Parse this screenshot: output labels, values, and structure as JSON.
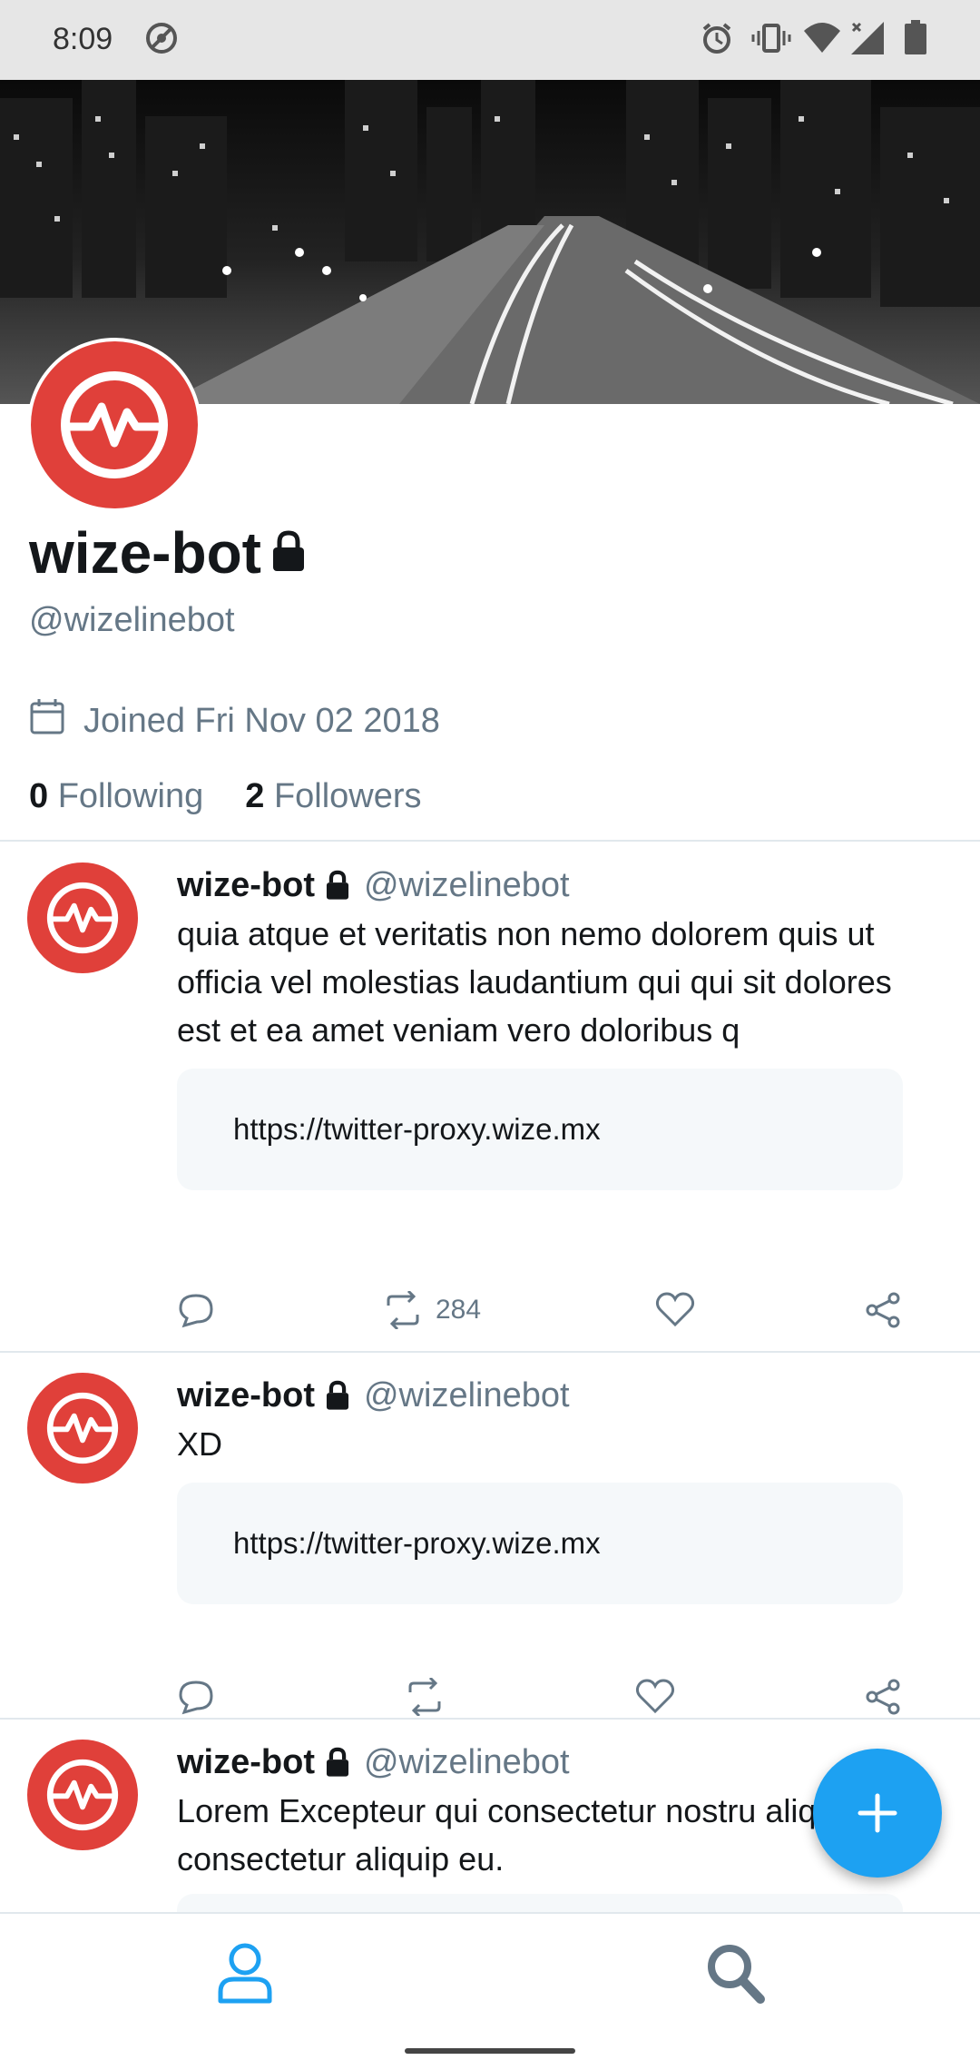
{
  "status_bar": {
    "time": "8:09",
    "icons": [
      "do-not-disturb-icon",
      "alarm-icon",
      "vibrate-icon",
      "wifi-icon",
      "cell-signal-icon",
      "battery-icon"
    ]
  },
  "profile": {
    "name": "wize-bot",
    "handle": "@wizelinebot",
    "joined": "Joined Fri Nov 02 2018",
    "following_count": "0",
    "following_label": "Following",
    "followers_count": "2",
    "followers_label": "Followers",
    "avatar_color": "#e0403a"
  },
  "tweets": [
    {
      "name": "wize-bot",
      "handle": "@wizelinebot",
      "text": "quia atque et veritatis non nemo dolorem quis ut officia vel molestias laudantium qui qui sit dolores est et ea amet veniam vero doloribus q",
      "link": "https://twitter-proxy.wize.mx",
      "retweet_count": "284"
    },
    {
      "name": "wize-bot",
      "handle": "@wizelinebot",
      "text": "XD",
      "link": "https://twitter-proxy.wize.mx",
      "retweet_count": ""
    },
    {
      "name": "wize-bot",
      "handle": "@wizelinebot",
      "text": "Lorem Excepteur qui consectetur nostru aliquip consectetur aliquip eu.",
      "link": "",
      "retweet_count": ""
    }
  ],
  "colors": {
    "accent": "#1da1f2",
    "brand_red": "#e0403a",
    "secondary_text": "#657786"
  },
  "bottom_nav": {
    "items": [
      "profile-icon",
      "search-icon"
    ],
    "active": "profile-icon"
  }
}
